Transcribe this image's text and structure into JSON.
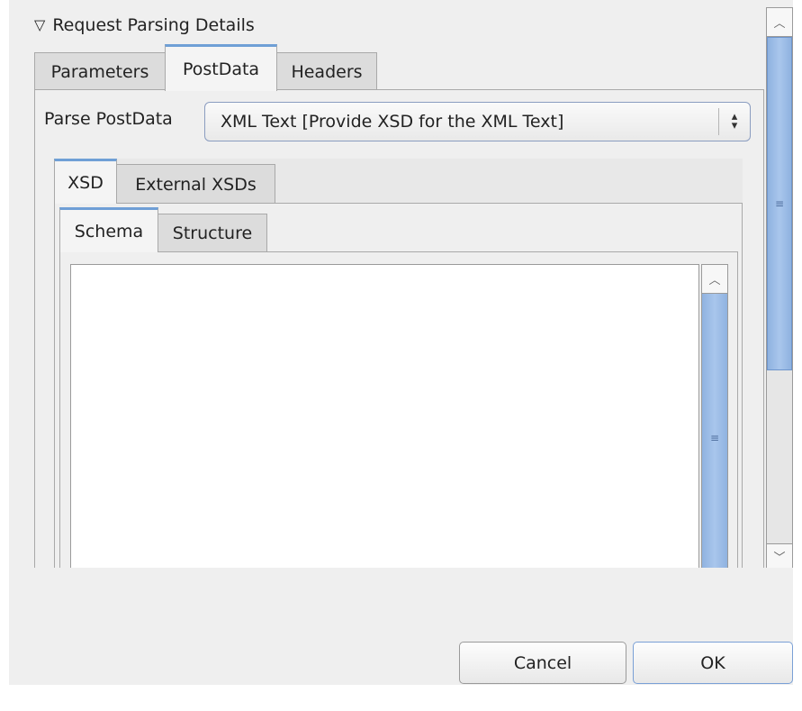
{
  "section": {
    "title": "Request Parsing Details",
    "toggle_icon": "triangle-down-icon"
  },
  "tabs_main": [
    {
      "label": "Parameters"
    },
    {
      "label": "PostData",
      "active": true
    },
    {
      "label": "Headers"
    }
  ],
  "postdata": {
    "parse_label": "Parse PostData",
    "parse_value": "XML Text  [Provide XSD for the XML Text]"
  },
  "tabs_xsd": [
    {
      "label": "XSD",
      "active": true
    },
    {
      "label": "External XSDs"
    }
  ],
  "tabs_schema": [
    {
      "label": "Schema",
      "active": true
    },
    {
      "label": "Structure"
    }
  ],
  "schema_text": "",
  "scroll": {
    "up_icon": "chevron-up-icon",
    "down_icon": "chevron-down-icon",
    "grip": "≡"
  },
  "buttons": {
    "cancel": "Cancel",
    "ok": "OK"
  },
  "colors": {
    "accent": "#6f9fd6",
    "thumb": "#a9c6ec",
    "background": "#efefef"
  }
}
